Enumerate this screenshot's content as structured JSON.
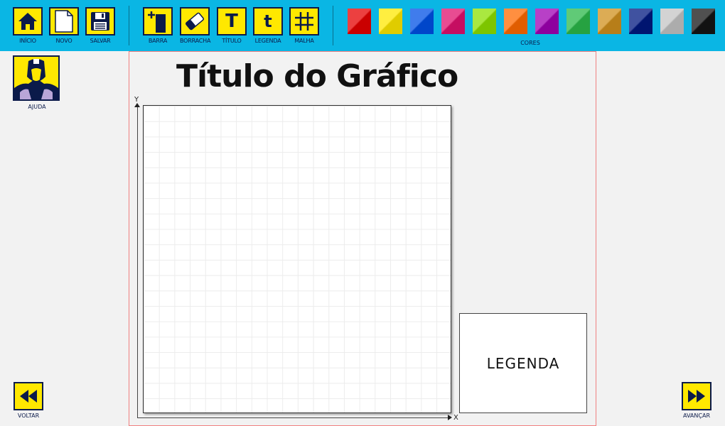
{
  "toolbar": {
    "tools": [
      {
        "label": "INÍCIO",
        "icon": "home-icon"
      },
      {
        "label": "NOVO",
        "icon": "new-page-icon"
      },
      {
        "label": "SALVAR",
        "icon": "save-icon"
      },
      {
        "label": "BARRA",
        "icon": "add-bar-icon"
      },
      {
        "label": "BORRACHA",
        "icon": "eraser-icon"
      },
      {
        "label": "TÍTULO",
        "icon": "title-icon",
        "glyph": "T"
      },
      {
        "label": "LEGENDA",
        "icon": "legend-icon",
        "glyph": "t"
      },
      {
        "label": "MALHA",
        "icon": "grid-icon"
      }
    ],
    "colors_label": "CORES",
    "colors": [
      "#e60000",
      "#ffe800",
      "#0050e6",
      "#e0106e",
      "#8ee000",
      "#ff6a00",
      "#a000b4",
      "#2bb84a",
      "#d0901c",
      "#001880",
      "#c4c4c4",
      "#151515"
    ]
  },
  "help": {
    "label": "AJUDA"
  },
  "chart": {
    "title": "Título do Gráfico",
    "y_axis": "Y",
    "x_axis": "X",
    "legend": "LEGENDA"
  },
  "nav": {
    "back_label": "VOLTAR",
    "next_label": "AVANÇAR"
  }
}
